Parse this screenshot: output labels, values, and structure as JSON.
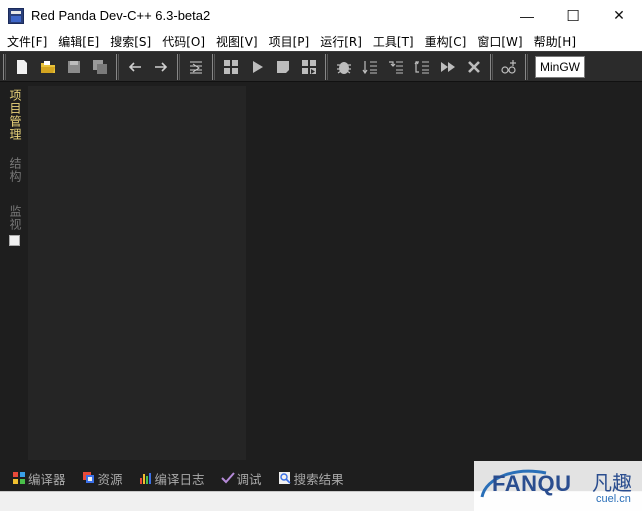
{
  "window": {
    "title": "Red Panda Dev-C++ 6.3-beta2",
    "minimize_glyph": "—",
    "maximize_glyph": "☐",
    "close_glyph": "✕"
  },
  "menu": {
    "items": [
      "文件[F]",
      "编辑[E]",
      "搜索[S]",
      "代码[O]",
      "视图[V]",
      "项目[P]",
      "运行[R]",
      "工具[T]",
      "重构[C]",
      "窗口[W]",
      "帮助[H]"
    ]
  },
  "toolbar": {
    "compiler_set": "MinGW",
    "icons": [
      "new-file-icon",
      "open-folder-icon",
      "save-icon",
      "save-all-icon",
      "undo-arrow-icon",
      "redo-arrow-icon",
      "format-code-icon",
      "compile-icon",
      "run-icon",
      "stop-icon",
      "compile-run-icon",
      "debug-bug-icon",
      "step-over-icon",
      "step-into-icon",
      "step-out-icon",
      "continue-icon",
      "stop-debug-icon",
      "add-watch-icon"
    ]
  },
  "left_tabs": {
    "project": "项目管理",
    "structure": "结构",
    "watch": "监视"
  },
  "bottom_tabs": {
    "compiler": "编译器",
    "resources": "资源",
    "compile_log": "编译日志",
    "debug": "调试",
    "search_results": "搜索结果"
  },
  "watermark": {
    "brand": "FANQU",
    "brand_cn": "凡趣",
    "domain": "cuel.cn"
  },
  "colors": {
    "dark_bg": "#1e1e1e",
    "panel_bg": "#252525",
    "toolbar_bg": "#2b2b2b",
    "active_tab_text": "#e8d27a",
    "watermark_blue": "#2a4d8f"
  }
}
